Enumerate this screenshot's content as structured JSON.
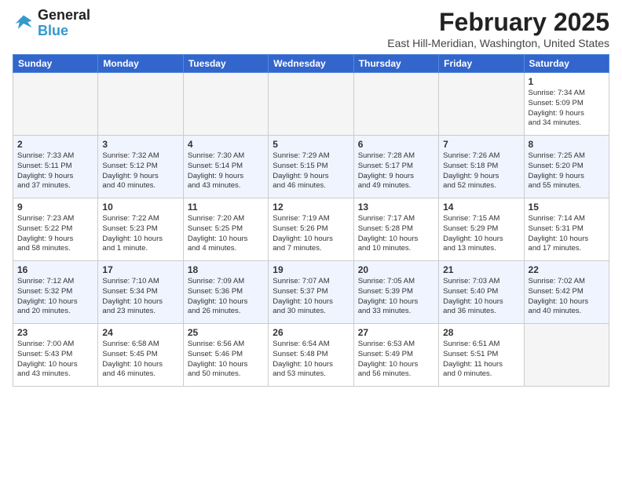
{
  "logo": {
    "line1": "General",
    "line2": "Blue"
  },
  "title": "February 2025",
  "subtitle": "East Hill-Meridian, Washington, United States",
  "weekdays": [
    "Sunday",
    "Monday",
    "Tuesday",
    "Wednesday",
    "Thursday",
    "Friday",
    "Saturday"
  ],
  "weeks": [
    [
      {
        "day": "",
        "detail": ""
      },
      {
        "day": "",
        "detail": ""
      },
      {
        "day": "",
        "detail": ""
      },
      {
        "day": "",
        "detail": ""
      },
      {
        "day": "",
        "detail": ""
      },
      {
        "day": "",
        "detail": ""
      },
      {
        "day": "1",
        "detail": "Sunrise: 7:34 AM\nSunset: 5:09 PM\nDaylight: 9 hours\nand 34 minutes."
      }
    ],
    [
      {
        "day": "2",
        "detail": "Sunrise: 7:33 AM\nSunset: 5:11 PM\nDaylight: 9 hours\nand 37 minutes."
      },
      {
        "day": "3",
        "detail": "Sunrise: 7:32 AM\nSunset: 5:12 PM\nDaylight: 9 hours\nand 40 minutes."
      },
      {
        "day": "4",
        "detail": "Sunrise: 7:30 AM\nSunset: 5:14 PM\nDaylight: 9 hours\nand 43 minutes."
      },
      {
        "day": "5",
        "detail": "Sunrise: 7:29 AM\nSunset: 5:15 PM\nDaylight: 9 hours\nand 46 minutes."
      },
      {
        "day": "6",
        "detail": "Sunrise: 7:28 AM\nSunset: 5:17 PM\nDaylight: 9 hours\nand 49 minutes."
      },
      {
        "day": "7",
        "detail": "Sunrise: 7:26 AM\nSunset: 5:18 PM\nDaylight: 9 hours\nand 52 minutes."
      },
      {
        "day": "8",
        "detail": "Sunrise: 7:25 AM\nSunset: 5:20 PM\nDaylight: 9 hours\nand 55 minutes."
      }
    ],
    [
      {
        "day": "9",
        "detail": "Sunrise: 7:23 AM\nSunset: 5:22 PM\nDaylight: 9 hours\nand 58 minutes."
      },
      {
        "day": "10",
        "detail": "Sunrise: 7:22 AM\nSunset: 5:23 PM\nDaylight: 10 hours\nand 1 minute."
      },
      {
        "day": "11",
        "detail": "Sunrise: 7:20 AM\nSunset: 5:25 PM\nDaylight: 10 hours\nand 4 minutes."
      },
      {
        "day": "12",
        "detail": "Sunrise: 7:19 AM\nSunset: 5:26 PM\nDaylight: 10 hours\nand 7 minutes."
      },
      {
        "day": "13",
        "detail": "Sunrise: 7:17 AM\nSunset: 5:28 PM\nDaylight: 10 hours\nand 10 minutes."
      },
      {
        "day": "14",
        "detail": "Sunrise: 7:15 AM\nSunset: 5:29 PM\nDaylight: 10 hours\nand 13 minutes."
      },
      {
        "day": "15",
        "detail": "Sunrise: 7:14 AM\nSunset: 5:31 PM\nDaylight: 10 hours\nand 17 minutes."
      }
    ],
    [
      {
        "day": "16",
        "detail": "Sunrise: 7:12 AM\nSunset: 5:32 PM\nDaylight: 10 hours\nand 20 minutes."
      },
      {
        "day": "17",
        "detail": "Sunrise: 7:10 AM\nSunset: 5:34 PM\nDaylight: 10 hours\nand 23 minutes."
      },
      {
        "day": "18",
        "detail": "Sunrise: 7:09 AM\nSunset: 5:36 PM\nDaylight: 10 hours\nand 26 minutes."
      },
      {
        "day": "19",
        "detail": "Sunrise: 7:07 AM\nSunset: 5:37 PM\nDaylight: 10 hours\nand 30 minutes."
      },
      {
        "day": "20",
        "detail": "Sunrise: 7:05 AM\nSunset: 5:39 PM\nDaylight: 10 hours\nand 33 minutes."
      },
      {
        "day": "21",
        "detail": "Sunrise: 7:03 AM\nSunset: 5:40 PM\nDaylight: 10 hours\nand 36 minutes."
      },
      {
        "day": "22",
        "detail": "Sunrise: 7:02 AM\nSunset: 5:42 PM\nDaylight: 10 hours\nand 40 minutes."
      }
    ],
    [
      {
        "day": "23",
        "detail": "Sunrise: 7:00 AM\nSunset: 5:43 PM\nDaylight: 10 hours\nand 43 minutes."
      },
      {
        "day": "24",
        "detail": "Sunrise: 6:58 AM\nSunset: 5:45 PM\nDaylight: 10 hours\nand 46 minutes."
      },
      {
        "day": "25",
        "detail": "Sunrise: 6:56 AM\nSunset: 5:46 PM\nDaylight: 10 hours\nand 50 minutes."
      },
      {
        "day": "26",
        "detail": "Sunrise: 6:54 AM\nSunset: 5:48 PM\nDaylight: 10 hours\nand 53 minutes."
      },
      {
        "day": "27",
        "detail": "Sunrise: 6:53 AM\nSunset: 5:49 PM\nDaylight: 10 hours\nand 56 minutes."
      },
      {
        "day": "28",
        "detail": "Sunrise: 6:51 AM\nSunset: 5:51 PM\nDaylight: 11 hours\nand 0 minutes."
      },
      {
        "day": "",
        "detail": ""
      }
    ]
  ]
}
